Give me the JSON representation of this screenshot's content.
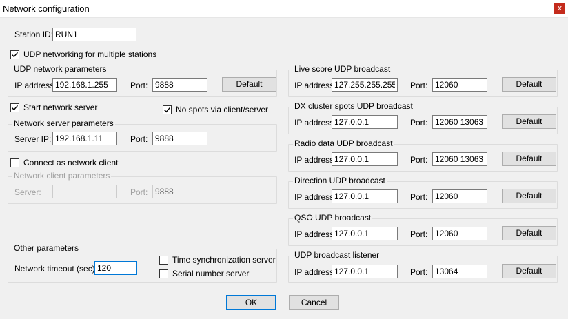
{
  "window": {
    "title": "Network configuration",
    "close_label": "x"
  },
  "station": {
    "label": "Station ID:",
    "value": "RUN1"
  },
  "udp_multi": {
    "label": "UDP networking for multiple stations",
    "checked": true
  },
  "udp_params": {
    "title": "UDP network parameters",
    "ip_label": "IP address:",
    "ip_value": "192.168.1.255",
    "port_label": "Port:",
    "port_value": "9888",
    "default_label": "Default"
  },
  "start_server": {
    "label": "Start network server",
    "checked": true
  },
  "no_spots": {
    "label": "No spots via client/server",
    "checked": true
  },
  "server_params": {
    "title": "Network server parameters",
    "ip_label": "Server IP:",
    "ip_value": "192.168.1.11",
    "port_label": "Port:",
    "port_value": "9888"
  },
  "connect_client": {
    "label": "Connect as network client",
    "checked": false
  },
  "client_params": {
    "title": "Network client parameters",
    "server_label": "Server:",
    "server_value": "",
    "port_label": "Port:",
    "port_value": "9888"
  },
  "other": {
    "title": "Other parameters",
    "timeout_label": "Network timeout (sec):",
    "timeout_value": "120",
    "time_sync_label": "Time synchronization server",
    "time_sync_checked": false,
    "serial_label": "Serial number server",
    "serial_checked": false
  },
  "broadcasts": [
    {
      "title": "Live score UDP broadcast",
      "ip_label": "IP address:",
      "ip_value": "127.255.255.255",
      "port_label": "Port:",
      "port_value": "12060",
      "default_label": "Default"
    },
    {
      "title": "DX cluster spots UDP broadcast",
      "ip_label": "IP address:",
      "ip_value": "127.0.0.1",
      "port_label": "Port:",
      "port_value": "12060 13063",
      "default_label": "Default"
    },
    {
      "title": "Radio data UDP broadcast",
      "ip_label": "IP address:",
      "ip_value": "127.0.0.1",
      "port_label": "Port:",
      "port_value": "12060 13063",
      "default_label": "Default"
    },
    {
      "title": "Direction UDP broadcast",
      "ip_label": "IP address:",
      "ip_value": "127.0.0.1",
      "port_label": "Port:",
      "port_value": "12060",
      "default_label": "Default"
    },
    {
      "title": "QSO UDP broadcast",
      "ip_label": "IP address:",
      "ip_value": "127.0.0.1",
      "port_label": "Port:",
      "port_value": "12060",
      "default_label": "Default"
    },
    {
      "title": "UDP broadcast listener",
      "ip_label": "IP address:",
      "ip_value": "127.0.0.1",
      "port_label": "Port:",
      "port_value": "13064",
      "default_label": "Default"
    }
  ],
  "buttons": {
    "ok_label": "OK",
    "cancel_label": "Cancel"
  },
  "colors": {
    "close": "#c42b1c",
    "focus": "#0078d7"
  }
}
